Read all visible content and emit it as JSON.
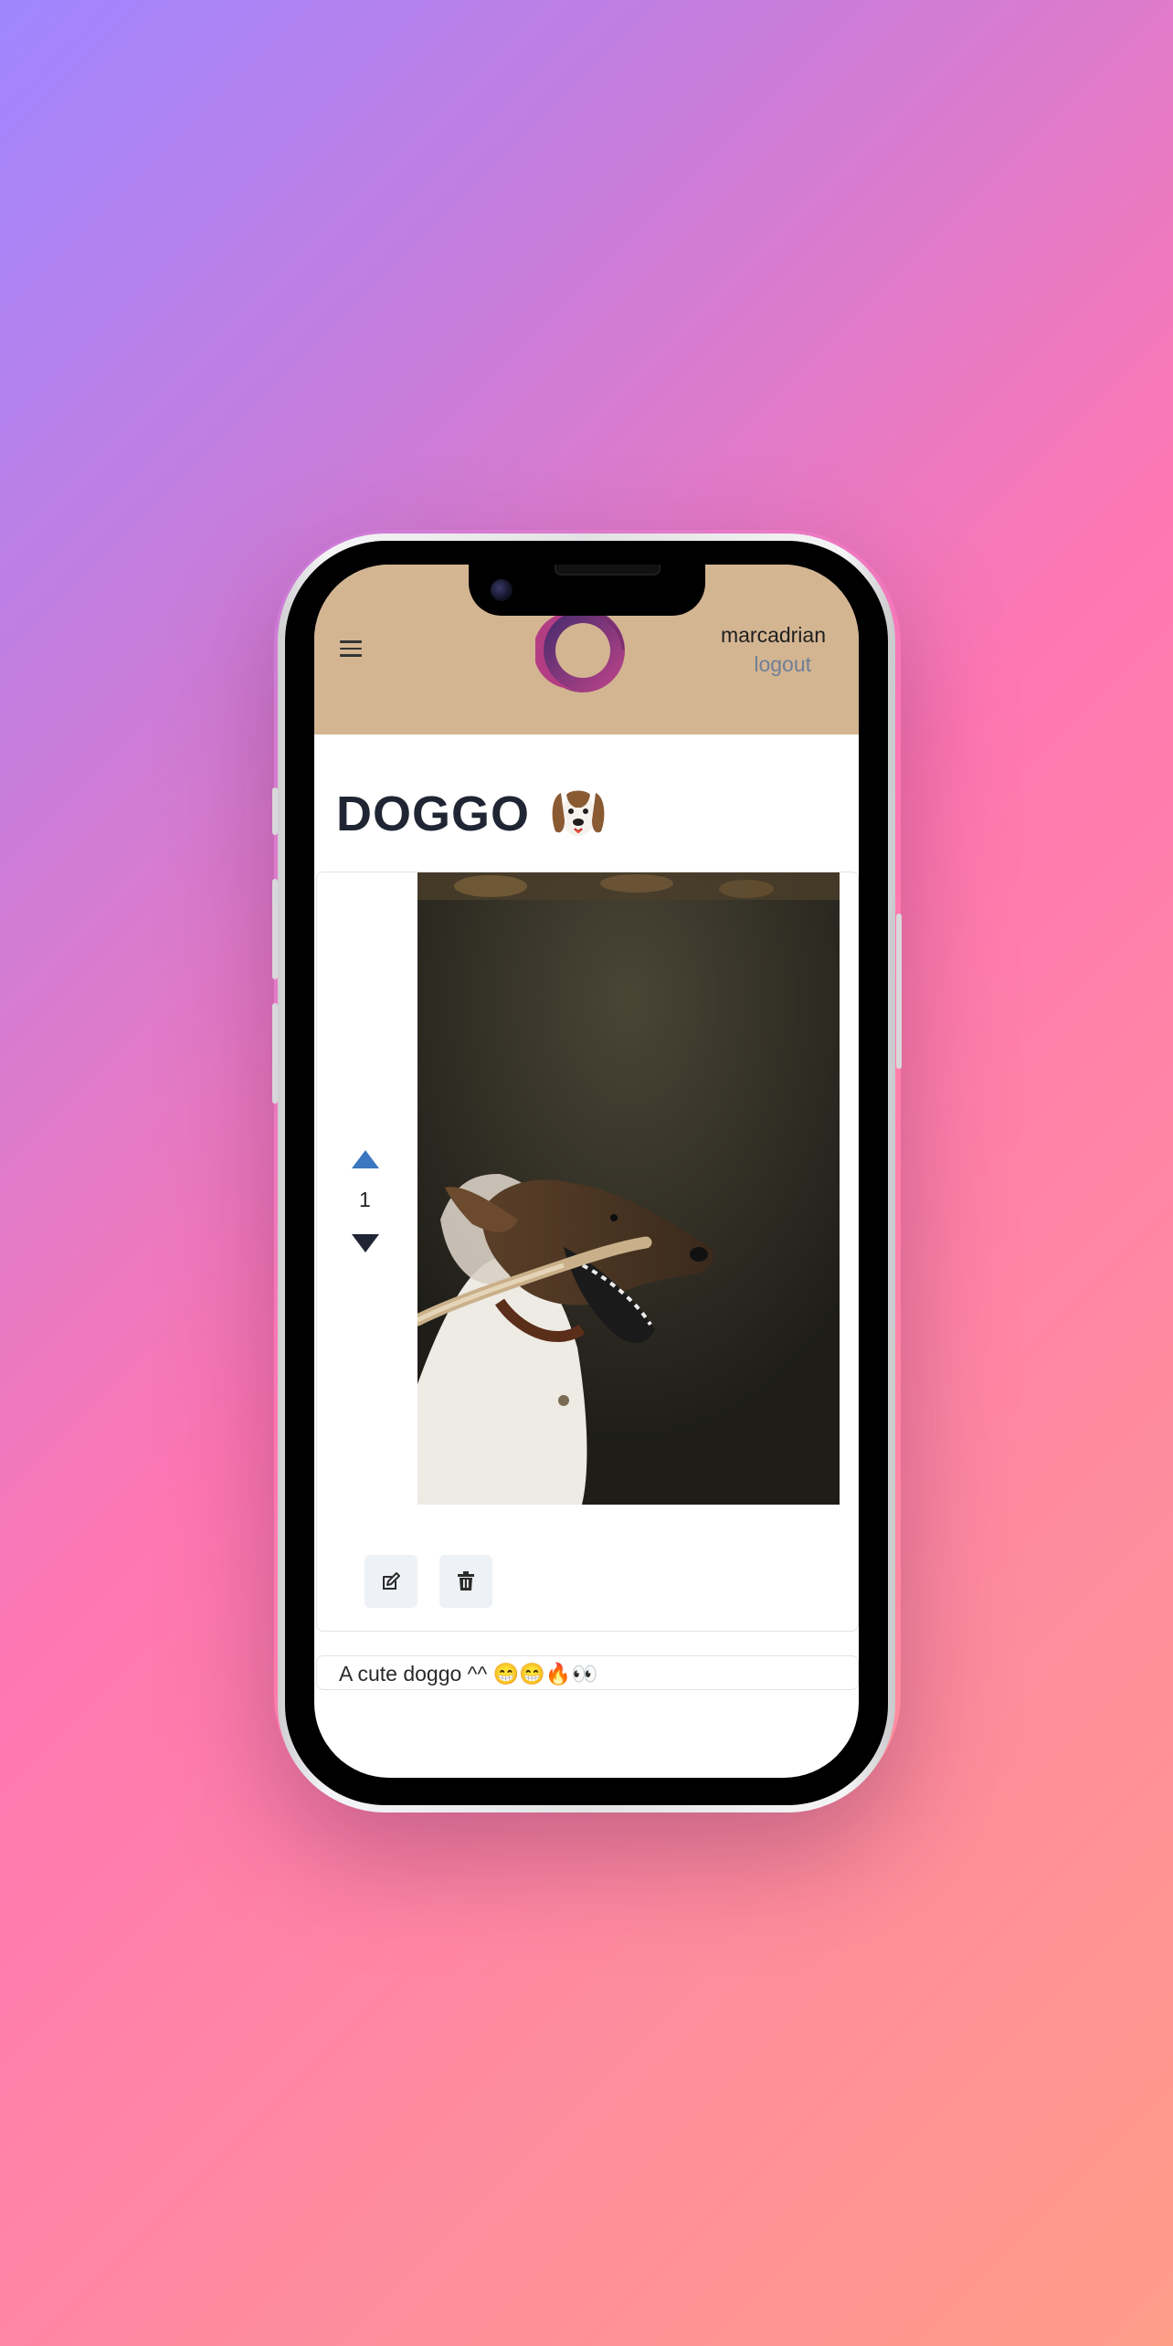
{
  "header": {
    "menu_icon": "hamburger-menu-icon",
    "logo_icon": "ring-logo-icon",
    "username": "marcadrian",
    "logout_label": "logout"
  },
  "post": {
    "title": "DOGGO",
    "title_emoji_icon": "dog-face-emoji-icon",
    "vote_count": "1",
    "caption": "A cute doggo ^^ 😁😁🔥👀",
    "image_subject": "dog-holding-stick-photo"
  },
  "actions": {
    "edit_icon": "edit-icon",
    "delete_icon": "trash-icon"
  },
  "colors": {
    "header_bg": "#d4b592",
    "vote_up": "#3b76c0",
    "vote_down": "#1f2533",
    "title": "#1f2533",
    "logout": "#6f7f96",
    "logo_gradient": [
      "#3d2a6b",
      "#b33d83"
    ]
  }
}
